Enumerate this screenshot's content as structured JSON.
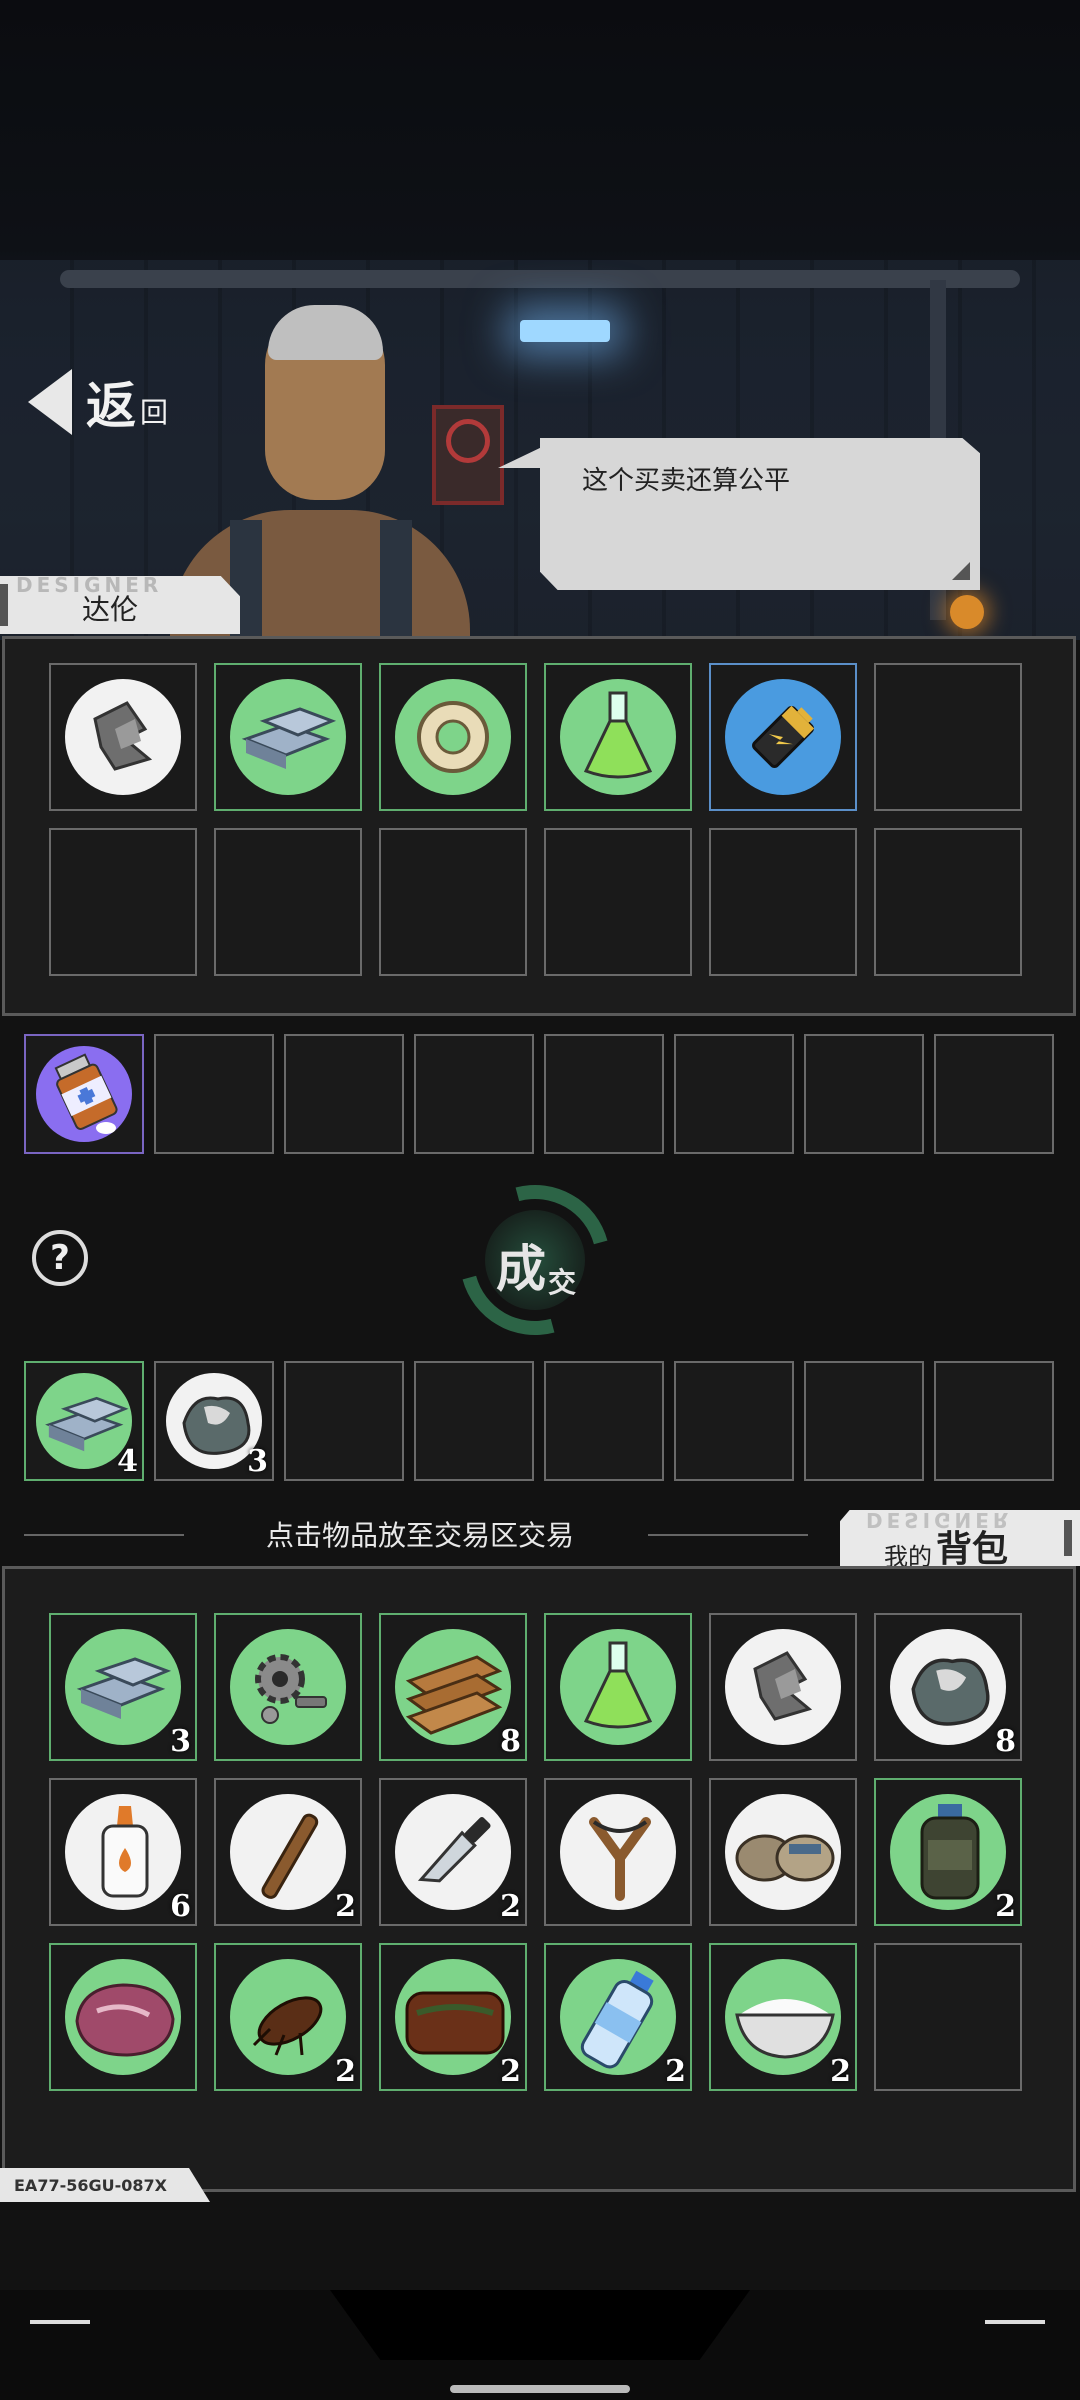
{
  "header": {
    "back_big": "返",
    "back_small": "回"
  },
  "npc": {
    "name": "达伦",
    "name_tag_deco": "DESIGNER",
    "dialogue": "这个买卖还算公平"
  },
  "trade": {
    "deal_big": "成",
    "deal_small": "交",
    "help_glyph": "?",
    "my_offer_counts": [
      "4",
      "3"
    ]
  },
  "bag": {
    "hint": "点击物品放至交易区交易",
    "tab_small": "我的",
    "tab_big": "背包",
    "tab_deco": "DESIGNER",
    "counts": [
      "3",
      "",
      "8",
      "",
      "",
      "8",
      "6",
      "2",
      "2",
      "",
      "",
      "2",
      "",
      "2",
      "2",
      "2",
      "2",
      ""
    ]
  },
  "footer": {
    "serial": "EA77-56GU-087X"
  },
  "colors": {
    "slot_green": "#5fae6f",
    "slot_blue": "#5b8fc9",
    "slot_purple": "#7a65c2",
    "deal_ring": "#2f6d4c"
  }
}
